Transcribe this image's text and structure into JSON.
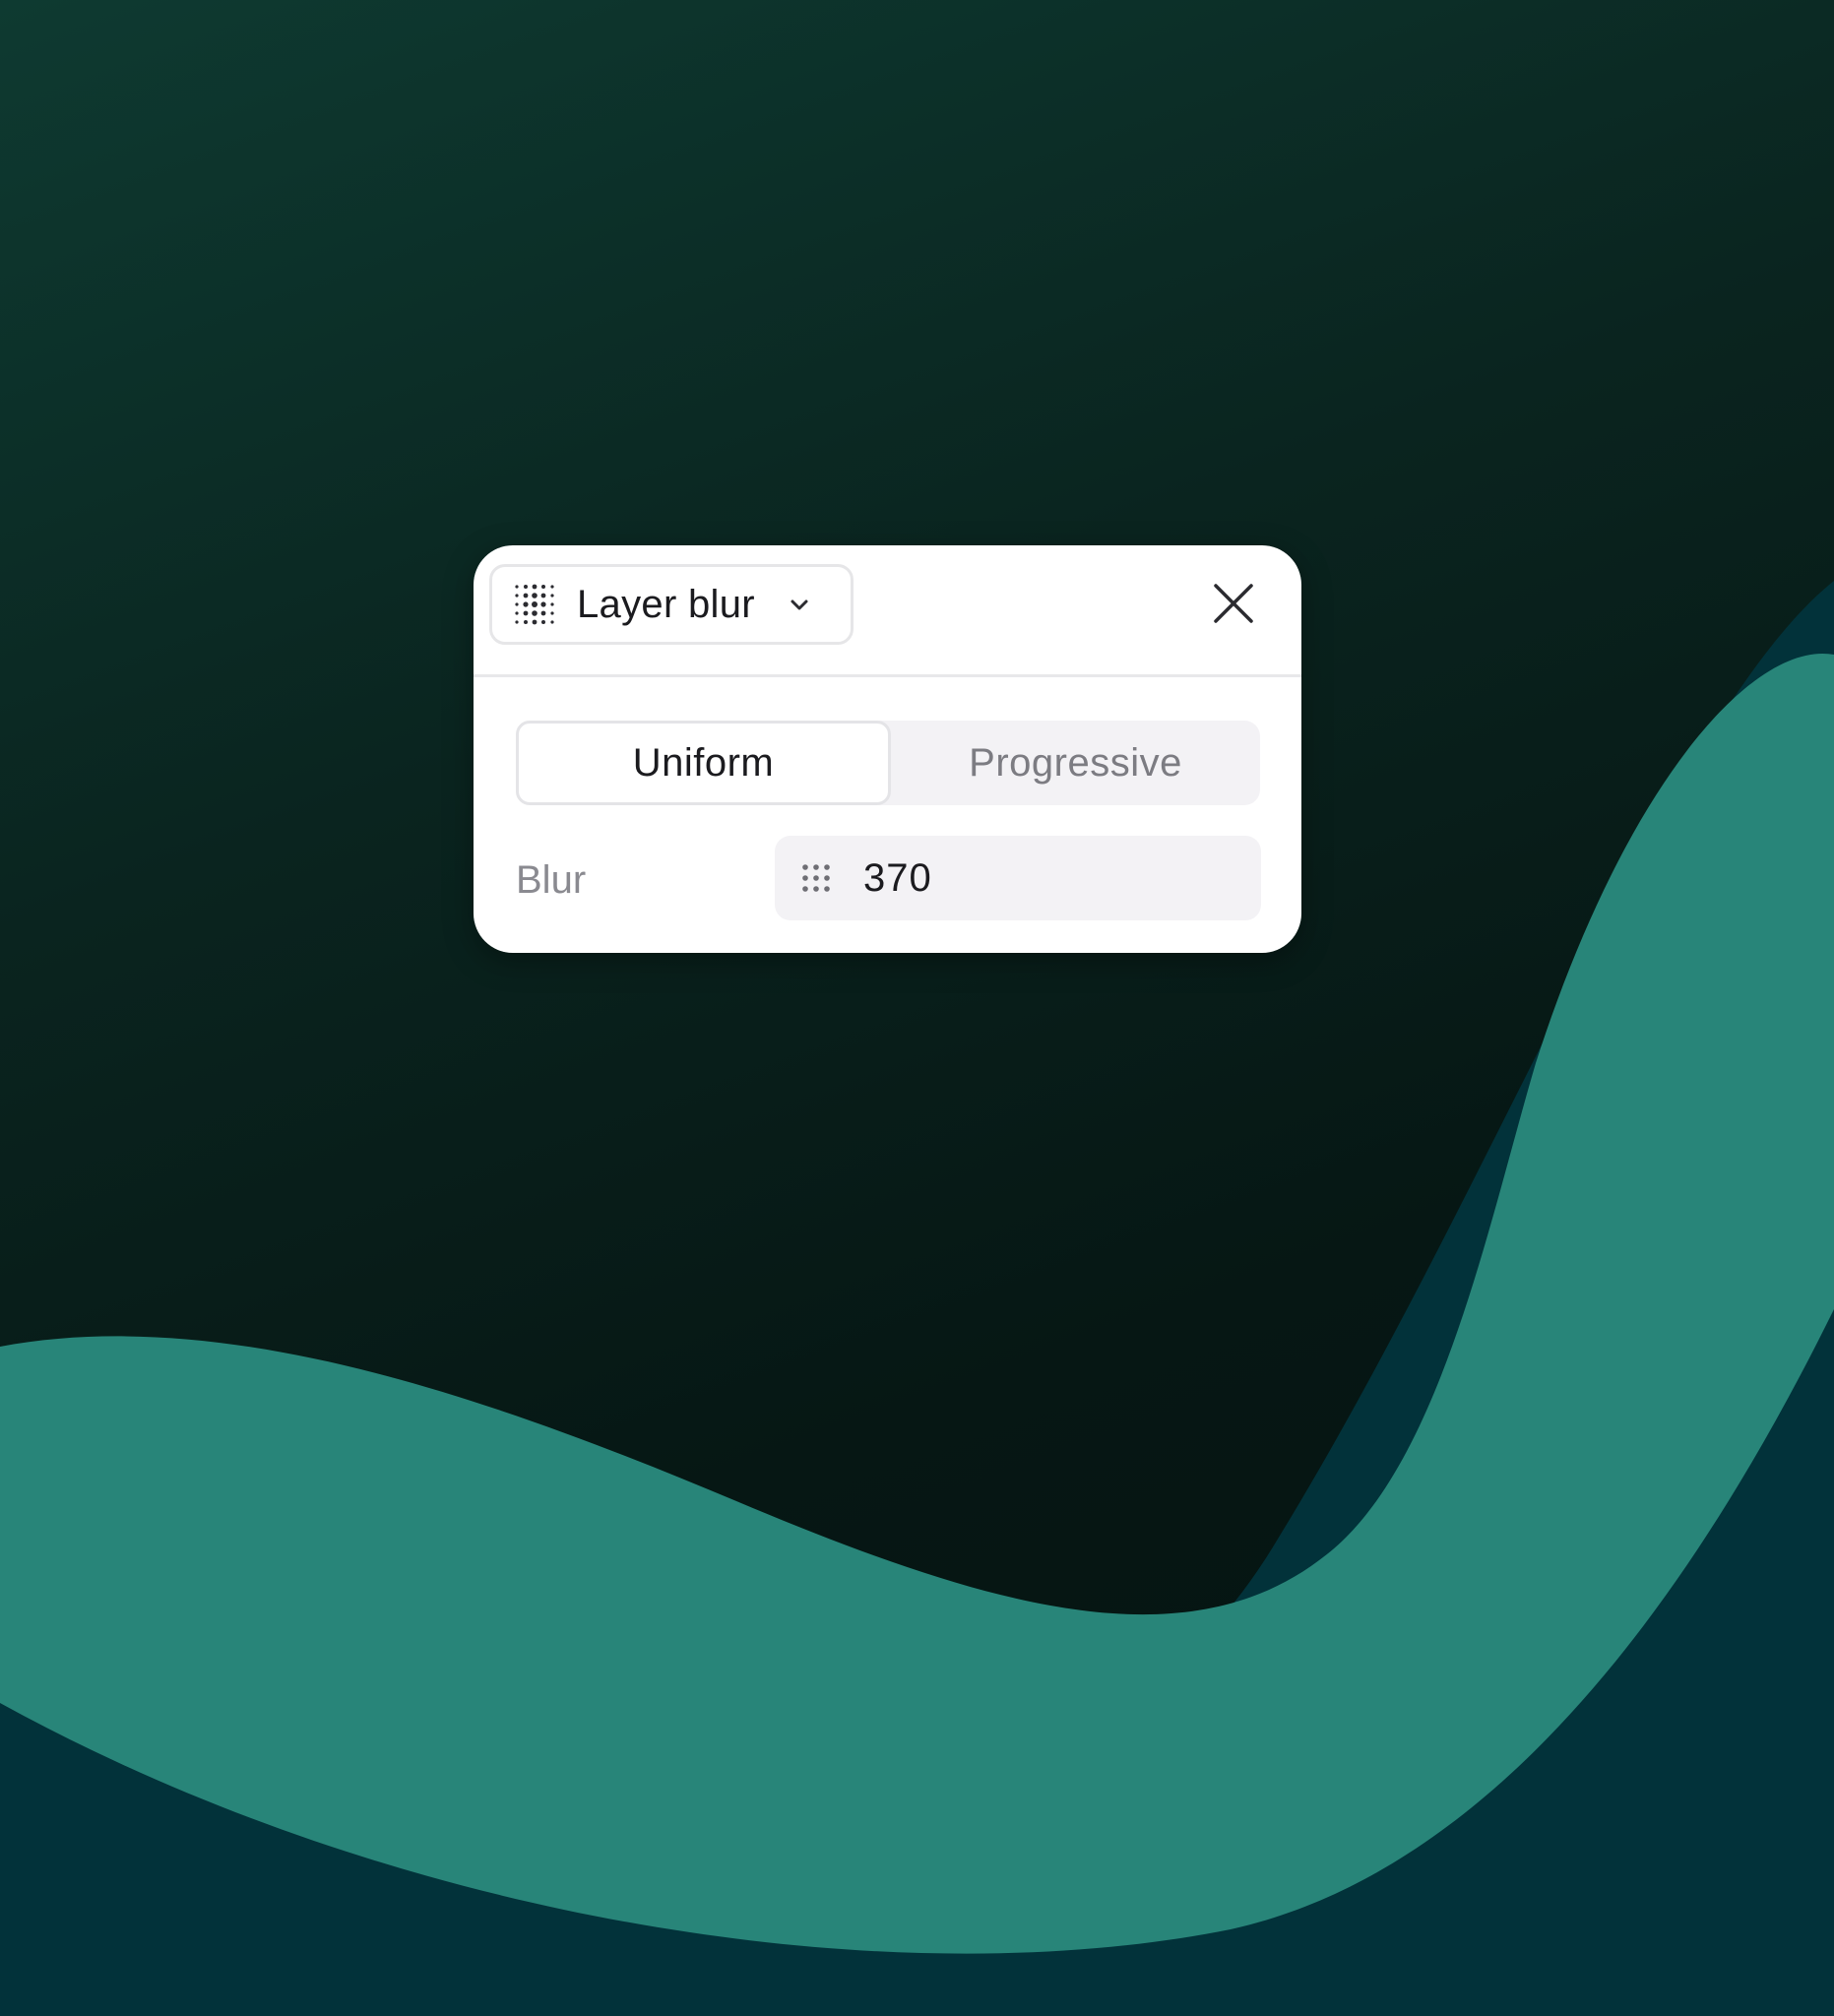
{
  "effect_dropdown": {
    "label": "Layer blur",
    "icon": "layer-blur-icon"
  },
  "close_icon": "close-icon",
  "blur_mode": {
    "options": [
      "Uniform",
      "Progressive"
    ],
    "selected": "Uniform"
  },
  "blur": {
    "label": "Blur",
    "value": "370"
  },
  "colors": {
    "teal_wave": "#288579",
    "deep_teal": "#02323a",
    "panel_bg": "#ffffff",
    "field_bg": "#f3f2f5"
  }
}
